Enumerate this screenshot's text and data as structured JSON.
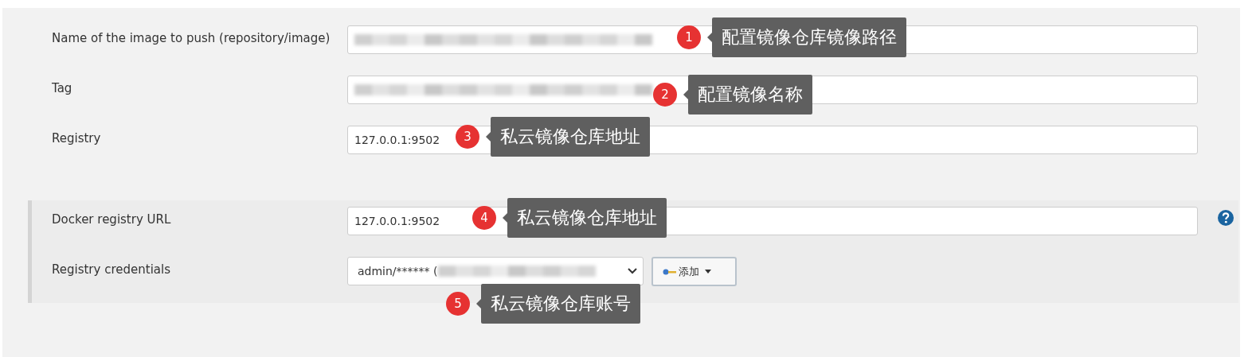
{
  "fields": [
    {
      "label": "Name of the image to push (repository/image)",
      "kind": "blurred"
    },
    {
      "label": "Tag",
      "kind": "blurred"
    },
    {
      "label": "Registry",
      "kind": "text",
      "value": "127.0.0.1:9502"
    }
  ],
  "registry_section": {
    "fields": [
      {
        "label": "Docker registry URL",
        "kind": "text",
        "value": "127.0.0.1:9502",
        "help": true
      },
      {
        "label": "Registry credentials",
        "kind": "select",
        "value": "admin/****** (",
        "add_button": "添加"
      }
    ]
  },
  "callouts": [
    {
      "number": "1",
      "text": "配置镜像仓库镜像路径"
    },
    {
      "number": "2",
      "text": "配置镜像名称"
    },
    {
      "number": "3",
      "text": "私云镜像仓库地址"
    },
    {
      "number": "4",
      "text": "私云镜像仓库地址"
    },
    {
      "number": "5",
      "text": "私云镜像仓库账号"
    }
  ]
}
